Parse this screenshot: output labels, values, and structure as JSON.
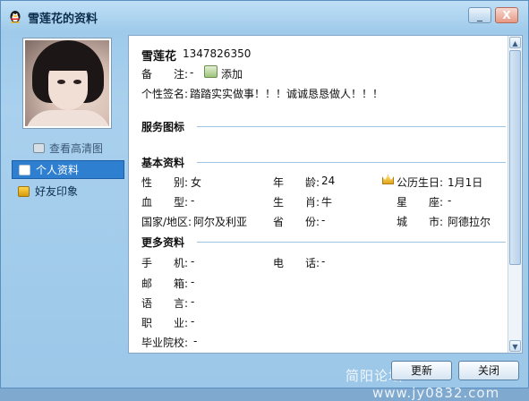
{
  "window": {
    "title": "雪莲花的资料",
    "minimize_glyph": "_",
    "close_glyph": "X"
  },
  "sidebar": {
    "hd_link": "查看高清图",
    "items": [
      {
        "label": "个人资料",
        "active": true,
        "icon": "person-card-icon"
      },
      {
        "label": "好友印象",
        "active": false,
        "icon": "friend-impression-icon"
      }
    ]
  },
  "profile": {
    "nickname": "雪莲花",
    "qq_number": "1347826350",
    "remark_label": "备　　注:",
    "remark_value": "-",
    "add_label": "添加",
    "signature_label": "个性签名:",
    "signature_value": "踏踏实实做事！！！诚诚恳恳做人！！！"
  },
  "sections": {
    "service": "服务图标",
    "basic": "基本资料",
    "more": "更多资料"
  },
  "basic_info": {
    "gender_label": "性　　别:",
    "gender_value": "女",
    "age_label": "年　　龄:",
    "age_value": "24",
    "birthday_label": "公历生日:",
    "birthday_value": "1月1日",
    "blood_label": "血　　型:",
    "blood_value": "-",
    "zodiac_label": "生　　肖:",
    "zodiac_value": "牛",
    "star_label": "星　　座:",
    "star_value": "-",
    "country_label": "国家/地区:",
    "country_value": "阿尔及利亚",
    "province_label": "省　　份:",
    "province_value": "-",
    "city_label": "城　　市:",
    "city_value": "阿德拉尔"
  },
  "more_info": {
    "phone_label": "手　　机:",
    "phone_value": "-",
    "tel_label": "电　　话:",
    "tel_value": "-",
    "email_label": "邮　　箱:",
    "email_value": "-",
    "lang_label": "语　　言:",
    "lang_value": "-",
    "job_label": "职　　业:",
    "job_value": "-",
    "school_label": "毕业院校:",
    "school_value": "-"
  },
  "buttons": {
    "refresh": "更新",
    "close": "关闭"
  },
  "watermark": {
    "text1": "简阳论坛",
    "text2": "www.jy0832.com"
  },
  "colors": {
    "accent": "#2f7fd1",
    "section_line": "#9fc3e2",
    "title_text": "#0d2d4e"
  }
}
